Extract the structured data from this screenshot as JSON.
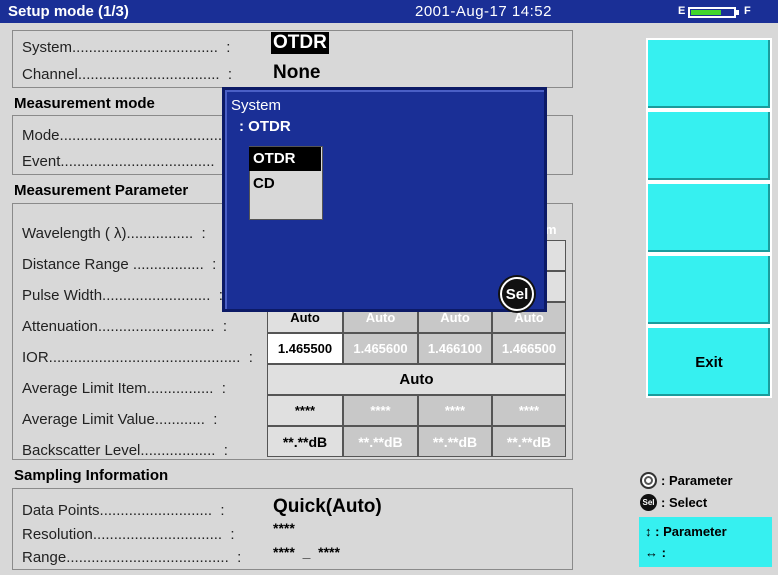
{
  "header": {
    "title": "Setup mode (1/3)",
    "datetime": "2001-Aug-17 14:52",
    "battery": {
      "empty_label": "E",
      "full_label": "F",
      "level": 0.75
    }
  },
  "system_section": {
    "system_label": "System...................................  :",
    "system_value": "OTDR",
    "channel_label": "Channel..................................  :",
    "channel_value": "None"
  },
  "measurement_mode": {
    "title": "Measurement mode",
    "mode_label": "Mode.......................................  :",
    "event_label": "Event.....................................  :"
  },
  "measurement_parameter": {
    "title": "Measurement Parameter",
    "rows": [
      {
        "label": "Wavelength ( λ)................  :"
      },
      {
        "label": "Distance Range .................  :"
      },
      {
        "label": "Pulse Width..........................  :"
      },
      {
        "label": "Attenuation............................  :"
      },
      {
        "label": "IOR..............................................  :"
      },
      {
        "label": "Average Limit Item................  :"
      },
      {
        "label": "Average Limit Value............  :"
      },
      {
        "label": "Backscatter Level..................  :"
      }
    ],
    "wavelength_unit": "nm",
    "attenuation": [
      "Auto",
      "Auto",
      "Auto",
      "Auto"
    ],
    "ior": [
      "1.465500",
      "1.465600",
      "1.466100",
      "1.466500"
    ],
    "average_limit_item": "Auto",
    "average_limit_value": [
      "****",
      "****",
      "****",
      "****"
    ],
    "backscatter": [
      "**.**dB",
      "**.**dB",
      "**.**dB",
      "**.**dB"
    ]
  },
  "sampling": {
    "title": "Sampling Information",
    "data_points_label": "Data Points...........................  :",
    "data_points_value": "Quick(Auto)",
    "resolution_label": "Resolution...............................  :",
    "resolution_value": "****",
    "range_label": "Range.......................................  :",
    "range_value": "****  _  ****"
  },
  "popup": {
    "title": "System",
    "current": ": OTDR",
    "options": [
      "OTDR",
      "CD"
    ],
    "selected": "OTDR",
    "sel_label": "Sel"
  },
  "function_keys": {
    "exit": "Exit"
  },
  "legend": {
    "parameter": ": Parameter",
    "select": ": Select",
    "sel_icon": "Sel",
    "arrow_up_down": "↕",
    "arrow_up_down_text": ": Parameter",
    "arrow_left_right": "↔",
    "arrow_left_right_text": ":"
  },
  "colors": {
    "title_bar": "#1a2f96",
    "function_key": "#36f0f0",
    "popup": "#1a2f96",
    "battery": "#41d62d"
  }
}
